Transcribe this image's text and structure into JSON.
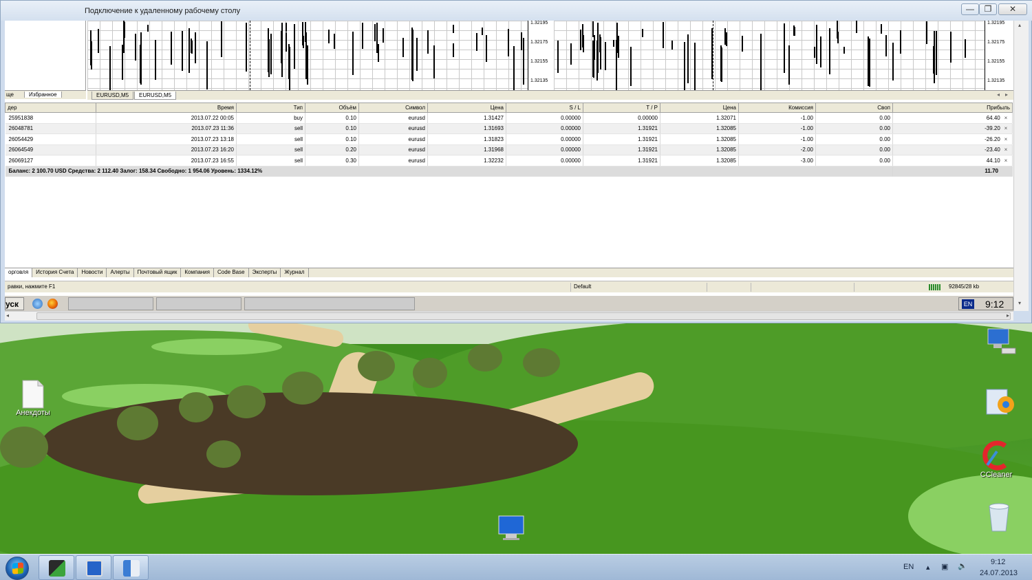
{
  "window": {
    "title": "Подключение к удаленному рабочему столу",
    "minimize_label": "—",
    "restore_label": "❐",
    "close_label": "✕"
  },
  "chart_panel": {
    "nav_tabs": [
      "ще",
      "Избранное"
    ],
    "chart_tabs": [
      "EURUSD,M5",
      "EURUSD,M5"
    ],
    "price_scale": [
      "1.32195",
      "1.32175",
      "1.32155",
      "1.32135"
    ]
  },
  "terminal": {
    "columns": [
      "дер",
      "Время",
      "Тип",
      "Объём",
      "Символ",
      "Цена",
      "S / L",
      "T / P",
      "Цена",
      "Комиссия",
      "Своп",
      "Прибыль"
    ],
    "rows": [
      {
        "order": "25951838",
        "time": "2013.07.22 00:05",
        "type": "buy",
        "volume": "0.10",
        "symbol": "eurusd",
        "price": "1.31427",
        "sl": "0.00000",
        "tp": "0.00000",
        "cur_price": "1.32071",
        "commission": "-1.00",
        "swap": "0.00",
        "profit": "64.40"
      },
      {
        "order": "26048781",
        "time": "2013.07.23 11:36",
        "type": "sell",
        "volume": "0.10",
        "symbol": "eurusd",
        "price": "1.31693",
        "sl": "0.00000",
        "tp": "1.31921",
        "cur_price": "1.32085",
        "commission": "-1.00",
        "swap": "0.00",
        "profit": "-39.20"
      },
      {
        "order": "26054429",
        "time": "2013.07.23 13:18",
        "type": "sell",
        "volume": "0.10",
        "symbol": "eurusd",
        "price": "1.31823",
        "sl": "0.00000",
        "tp": "1.31921",
        "cur_price": "1.32085",
        "commission": "-1.00",
        "swap": "0.00",
        "profit": "-26.20"
      },
      {
        "order": "26064549",
        "time": "2013.07.23 16:20",
        "type": "sell",
        "volume": "0.20",
        "symbol": "eurusd",
        "price": "1.31968",
        "sl": "0.00000",
        "tp": "1.31921",
        "cur_price": "1.32085",
        "commission": "-2.00",
        "swap": "0.00",
        "profit": "-23.40"
      },
      {
        "order": "26069127",
        "time": "2013.07.23 16:55",
        "type": "sell",
        "volume": "0.30",
        "symbol": "eurusd",
        "price": "1.32232",
        "sl": "0.00000",
        "tp": "1.31921",
        "cur_price": "1.32085",
        "commission": "-3.00",
        "swap": "0.00",
        "profit": "44.10"
      }
    ],
    "close_glyph": "×",
    "summary": "Баланс: 2 100.70 USD  Средства: 2 112.40  Залог: 158.34  Свободно: 1 954.06  Уровень: 1334.12%",
    "summary_profit": "11.70",
    "tabs": [
      "орговля",
      "История Счета",
      "Новости",
      "Алерты",
      "Почтовый ящик",
      "Компания",
      "Code Base",
      "Эксперты",
      "Журнал"
    ]
  },
  "statusbar": {
    "help": "равки, нажмите F1",
    "profile": "Default",
    "traffic": "92845/28 kb"
  },
  "remote_taskbar": {
    "start_label": "уск",
    "lang": "EN",
    "clock": "9:12"
  },
  "desktop": {
    "icons": [
      {
        "label": "Анекдоты",
        "icon": "text-file-icon"
      },
      {
        "label": "",
        "icon": "network-computer-icon"
      },
      {
        "label": "",
        "icon": "control-panel-icon"
      },
      {
        "label": "CCleaner",
        "icon": "ccleaner-icon"
      },
      {
        "label": "",
        "icon": "recycle-bin-icon"
      },
      {
        "label": "",
        "icon": "remote-desktop-icon"
      }
    ]
  },
  "taskbar": {
    "lang": "EN",
    "time": "9:12",
    "date": "24.07.2013"
  }
}
